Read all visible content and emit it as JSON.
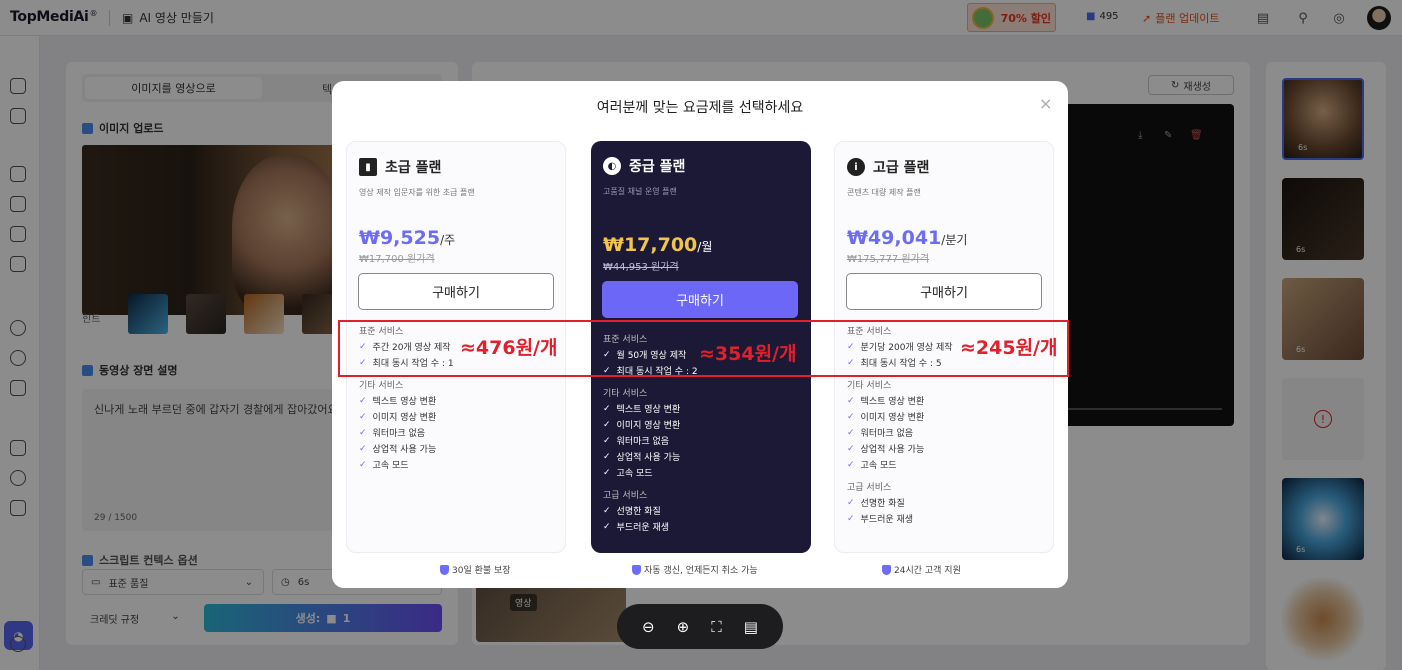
{
  "app": {
    "logo": "TopMediAi",
    "logo_mark": "®",
    "title": "AI 영상 만들기",
    "promo": "70% 할인",
    "credits": "495",
    "upgrade": "플랜 업데이트"
  },
  "left": {
    "tab_active": "이미지를 영상으로",
    "tab_other": "텍스트",
    "upload_title": "이미지 업로드",
    "hint_label": "힌트",
    "desc_title": "동영상 장면 설명",
    "desc_text": "신나게 노래 부르던 중에 갑자기 경찰에게 잡아갔어요",
    "desc_count": "29 / 1500",
    "partial_section": "스크립트 컨텍스 옵션",
    "quality": "표준 품질",
    "duration": "6s",
    "credit_rule": "크레딧 규정",
    "generate_label": "생성:",
    "generate_cost": "1"
  },
  "mid": {
    "regen": "재생성",
    "badge": "영상"
  },
  "right": {
    "thumbs": [
      {
        "duration": "6s"
      },
      {
        "duration": "6s"
      },
      {
        "duration": "6s"
      },
      {
        "duration": ""
      },
      {
        "duration": "6s"
      },
      {
        "duration": "6s"
      }
    ]
  },
  "modal": {
    "title": "여러분께 맞는 요금제를 선택하세요",
    "close": "×",
    "plans": [
      {
        "name": "초급 플랜",
        "subtitle": "영상 제작 입문자를 위한 초급 플랜",
        "price": "₩9,525",
        "period": "/주",
        "original": "₩17,700 원가격",
        "buy": "구매하기",
        "standard_head": "표준 서비스",
        "standard": [
          "주간 20개 영상 제작",
          "최대 동시 작업 수 : 1"
        ],
        "other_head": "기타 서비스",
        "other": [
          "텍스트 영상 변환",
          "이미지 영상 변환",
          "워터마크 없음",
          "상업적 사용 가능",
          "고속 모드"
        ],
        "premium_head": "",
        "premium": [],
        "per_unit": "≈476원/개",
        "guarantee": "30일 환불 보장"
      },
      {
        "name": "중급 플랜",
        "subtitle": "고품질 채널 운영 플랜",
        "price": "₩17,700",
        "period": "/월",
        "original": "₩44,953 원가격",
        "buy": "구매하기",
        "standard_head": "표준 서비스",
        "standard": [
          "월 50개 영상 제작",
          "최대 동시 작업 수 : 2"
        ],
        "other_head": "기타 서비스",
        "other": [
          "텍스트 영상 변환",
          "이미지 영상 변환",
          "워터마크 없음",
          "상업적 사용 가능",
          "고속 모드"
        ],
        "premium_head": "고급 서비스",
        "premium": [
          "선명한 화질",
          "부드러운 재생"
        ],
        "per_unit": "≈354원/개",
        "guarantee": "자동 갱신, 언제든지 취소 가능"
      },
      {
        "name": "고급 플랜",
        "subtitle": "콘텐츠 대량 제작 플랜",
        "price": "₩49,041",
        "period": "/분기",
        "original": "₩175,777 원가격",
        "buy": "구매하기",
        "standard_head": "표준 서비스",
        "standard": [
          "분기당 200개 영상 제작",
          "최대 동시 작업 수 : 5"
        ],
        "other_head": "기타 서비스",
        "other": [
          "텍스트 영상 변환",
          "이미지 영상 변환",
          "워터마크 없음",
          "상업적 사용 가능",
          "고속 모드"
        ],
        "premium_head": "고급 서비스",
        "premium": [
          "선명한 화질",
          "부드러운 재생"
        ],
        "per_unit": "≈245원/개",
        "guarantee": "24시간 고객 지원"
      }
    ]
  },
  "colors": {
    "accent": "#6c67f7",
    "highlight_red": "#e0202b",
    "dark_card": "#1c1936",
    "price_gold": "#f2c44d"
  }
}
